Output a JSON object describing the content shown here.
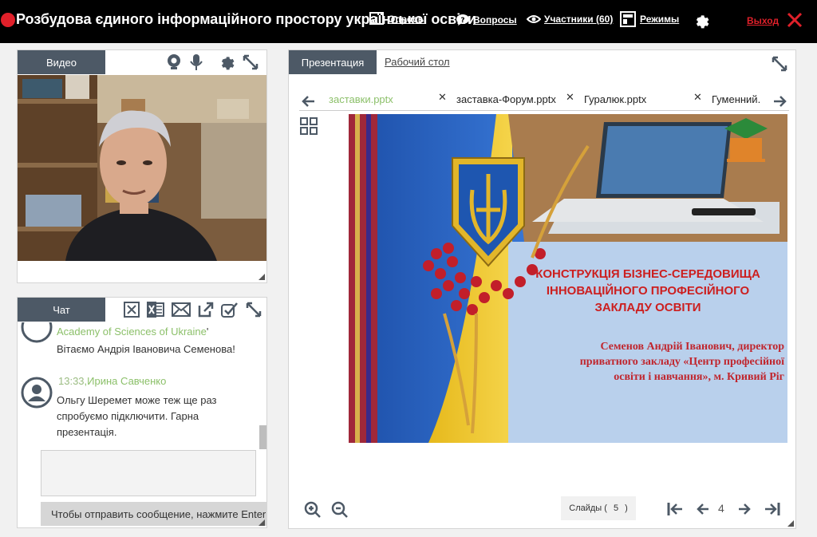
{
  "topbar": {
    "title": "Розбудова єдиного інформаційного простору української освіти",
    "menu_extra_label": "Опросы",
    "questions_label": "Вопросы",
    "participants_label": "Участники (60)",
    "modes_label": "Режимы",
    "exit_label": "Выход"
  },
  "video_panel": {
    "tab_label": "Видео"
  },
  "chat_panel": {
    "tab_label": "Чат",
    "messages": [
      {
        "author_tail": "Academy of Sciences of Ukraine",
        "text": "Вітаємо Андрія Івановича Семенова!"
      },
      {
        "time": "13:33",
        "author": "Ирина Савченко",
        "text": "Ольгу Шеремет може теж ще раз спробуємо підключити. Гарна презентація."
      }
    ],
    "input_hint": "Чтобы отправить сообщение, нажмите Enter"
  },
  "presentation_panel": {
    "tab_label": "Презентация",
    "tab2_label": "Рабочий стол",
    "files": [
      "заставки.pptx",
      "заставка-Форум.pptx",
      "Гуралюк.pptx",
      "Гуменний."
    ],
    "slide": {
      "heading_line1": "КОНСТРУКЦІЯ БІЗНЕС-СЕРЕДОВИЩА",
      "heading_line2": "ІННОВАЦІЙНОГО ПРОФЕСІЙНОГО",
      "heading_line3": "ЗАКЛАДУ ОСВІТИ",
      "author_name": "Семенов Андрій Іванович",
      "author_line1": ", директор",
      "author_line2": "приватного закладу «Центр професійної",
      "author_line3": "освіти і навчання», м. Кривий Ріг"
    },
    "slides_label": "Слайды (",
    "slides_total": "5",
    "slides_close": ")",
    "current_page": "4"
  },
  "colors": {
    "topbar_bg": "#000000",
    "record": "#e0202a",
    "tab_bg": "#4d5966",
    "active_file": "#8cc06a",
    "slide_heading": "#cc1f1f",
    "slide_author": "#c0262e"
  }
}
